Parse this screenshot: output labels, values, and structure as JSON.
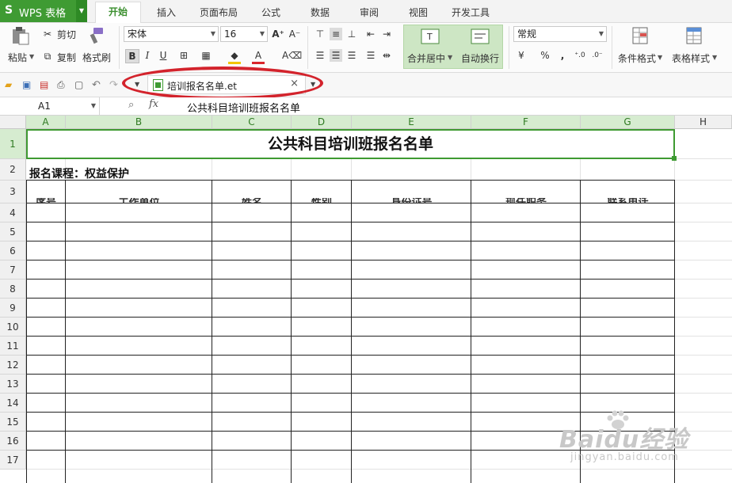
{
  "app": {
    "logo": "S",
    "title": "WPS 表格"
  },
  "menu_tabs": [
    "开始",
    "插入",
    "页面布局",
    "公式",
    "数据",
    "审阅",
    "视图",
    "开发工具"
  ],
  "active_tab": "开始",
  "ribbon": {
    "cut": "剪切",
    "copy": "复制",
    "paste": "粘贴",
    "format_painter": "格式刷",
    "font_name": "宋体",
    "font_size": "16",
    "merge_center": "合并居中",
    "wrap_text": "自动换行",
    "number_format": "常规",
    "conditional_format": "条件格式",
    "table_style": "表格样式",
    "bold": "B",
    "italic": "I",
    "underline": "U",
    "percent": "%",
    "comma": ","
  },
  "file_tab": {
    "name": "培训报名名单.et",
    "close": "×"
  },
  "formula_bar": {
    "cell_ref": "A1",
    "fx": "fx",
    "value": "公共科目培训班报名名单"
  },
  "columns": [
    "A",
    "B",
    "C",
    "D",
    "E",
    "F",
    "G",
    "H"
  ],
  "rows": [
    "1",
    "2",
    "3",
    "4",
    "5",
    "6",
    "7",
    "8",
    "9",
    "10",
    "11",
    "12",
    "13",
    "14",
    "15",
    "16",
    "17"
  ],
  "sheet": {
    "title": "公共科目培训班报名名单",
    "course": "报名课程：权益保护",
    "headers": [
      "序号",
      "工作单位",
      "姓名",
      "性别",
      "身份证号",
      "现任职务",
      "联系电话"
    ]
  },
  "watermark": {
    "brand": "Baidu经验",
    "url": "jingyan.baidu.com"
  },
  "colors": {
    "brand_green": "#3f9b33",
    "selection_green": "#3e9a31",
    "annotation_red": "#d3232c"
  }
}
